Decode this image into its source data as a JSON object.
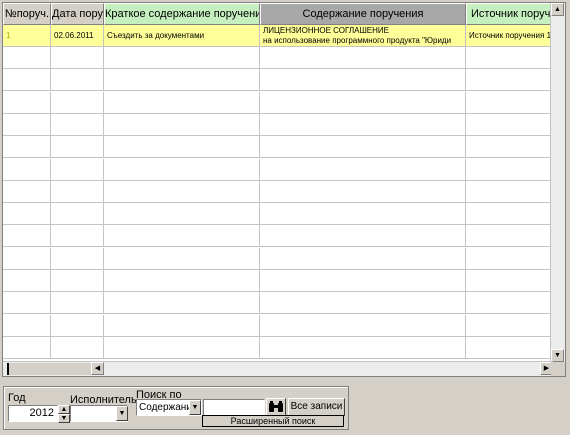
{
  "grid": {
    "columns": [
      {
        "label": "№поруч."
      },
      {
        "label": "Дата поруч."
      },
      {
        "label": "Краткое содержание поручения"
      },
      {
        "label": "Содержание поручения"
      },
      {
        "label": "Источник поручения"
      }
    ],
    "rows": [
      {
        "number": "1",
        "date": "02.06.2011",
        "brief": "Съездить за документами",
        "content_line1": "ЛИЦЕНЗИОННОЕ СОГЛАШЕНИЕ",
        "content_line2": "на использование программного продукта \"Юриди",
        "source": "Источник поручения 1"
      }
    ]
  },
  "filters": {
    "year_label": "Год",
    "year_value": "2012",
    "executor_label": "Исполнитель",
    "executor_value": "",
    "search_by_label": "Поиск по",
    "search_by_value": "Содержани",
    "search_text": "",
    "all_records_label": "Все записи",
    "advanced_search_label": "Расширенный поиск"
  },
  "icons": {
    "binoculars": "binoculars-icon"
  },
  "colors": {
    "selected_row": "#ffff99",
    "header_green": "#c6efc0",
    "header_dark": "#a8a8a8"
  }
}
